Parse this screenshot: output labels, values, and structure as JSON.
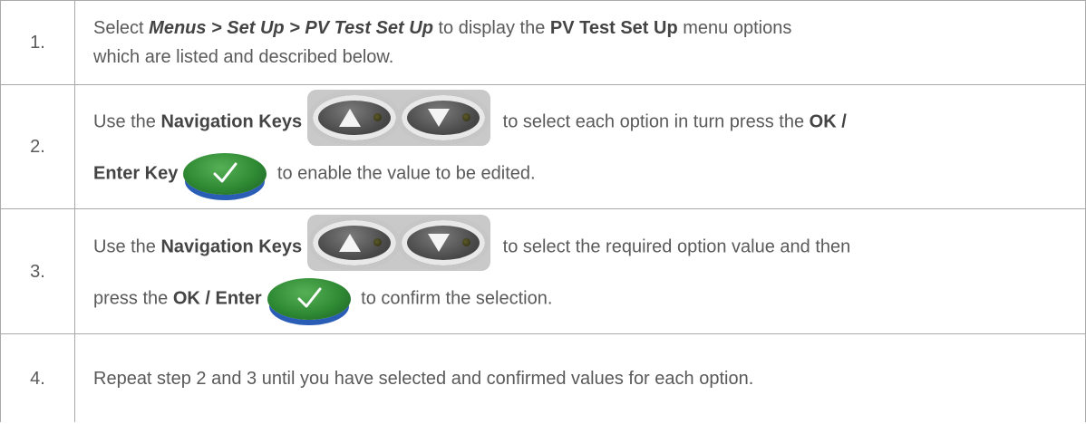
{
  "steps": [
    {
      "number": "1.",
      "lines": [
        {
          "t1": "Select ",
          "menu_path": "Menus > Set Up > PV Test Set Up",
          "t2": " to display the ",
          "menu_name": "PV Test Set Up",
          "t3": " menu options"
        },
        {
          "t1": "which are listed and described below."
        }
      ]
    },
    {
      "number": "2.",
      "lines": [
        {
          "t1": "Use the ",
          "b1": "Navigation Keys",
          "t2": " to select each option in turn press the ",
          "b2": "OK /"
        },
        {
          "b1": "Enter Key",
          "t2": " to enable the value to be edited."
        }
      ]
    },
    {
      "number": "3.",
      "lines": [
        {
          "t1": "Use the ",
          "b1": "Navigation Keys",
          "t2": " to select the required option value and then"
        },
        {
          "t1": "press the ",
          "b1": "OK / Enter",
          "t2": " to confirm the selection."
        }
      ]
    },
    {
      "number": "4.",
      "lines": [
        {
          "t1": "Repeat step 2 and 3 until you have selected and confirmed values for each option."
        }
      ]
    }
  ],
  "icons": {
    "nav_up": "navigation-up-key-icon",
    "nav_down": "navigation-down-key-icon",
    "ok": "ok-enter-key-icon"
  },
  "colors": {
    "text": "#5a5a5a",
    "border": "#a9a9a9",
    "ok_green": "#2f8a34",
    "ok_blue": "#2a5db5"
  }
}
